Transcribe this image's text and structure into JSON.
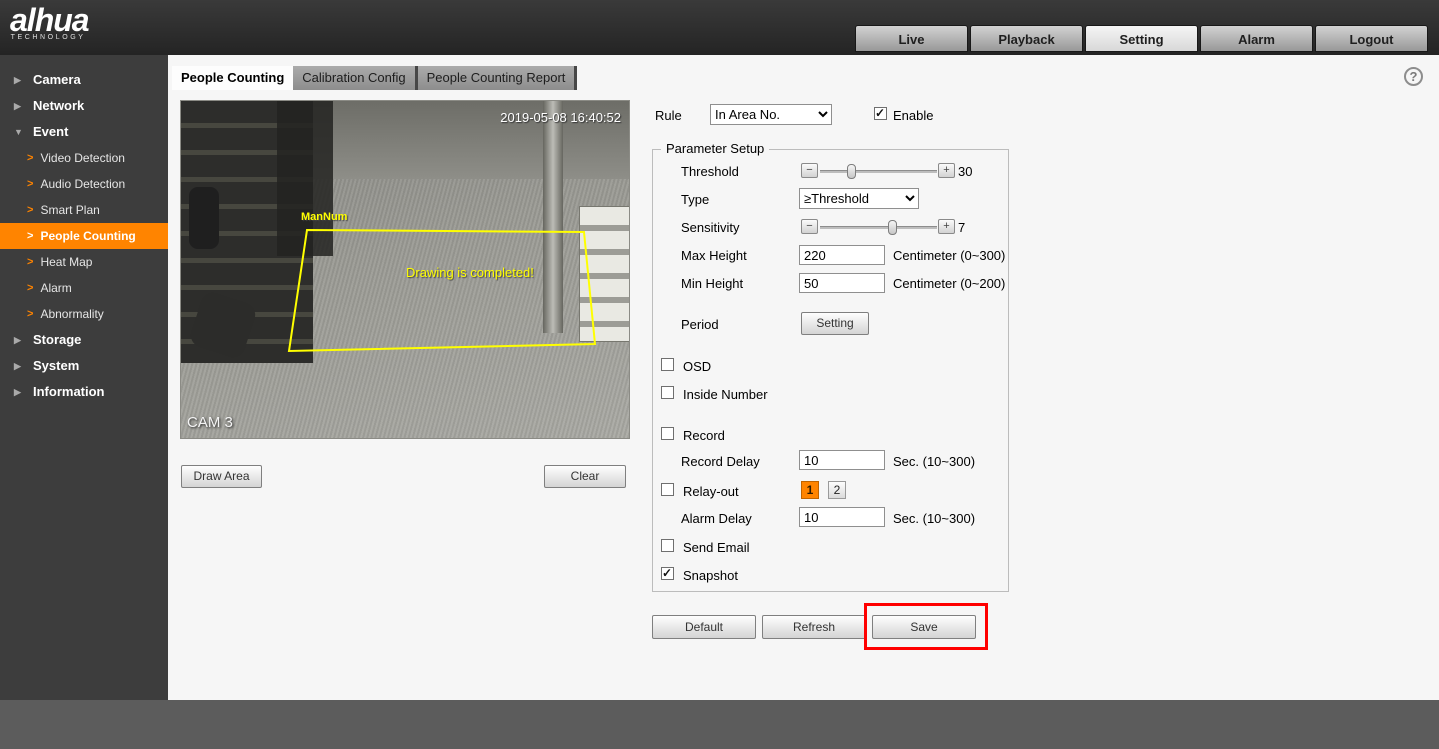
{
  "header": {
    "logo_text": "alhua",
    "logo_sub": "TECHNOLOGY",
    "nav_live": "Live",
    "nav_playback": "Playback",
    "nav_setting": "Setting",
    "nav_alarm": "Alarm",
    "nav_logout": "Logout"
  },
  "icons": {
    "collapsed": "▶",
    "expanded": "▼",
    "sub": ">",
    "help": "?"
  },
  "sidebar": {
    "camera": "Camera",
    "network": "Network",
    "event": "Event",
    "video_detection": "Video Detection",
    "audio_detection": "Audio Detection",
    "smart_plan": "Smart Plan",
    "people_counting": "People Counting",
    "heat_map": "Heat Map",
    "alarm": "Alarm",
    "abnormality": "Abnormality",
    "storage": "Storage",
    "system": "System",
    "information": "Information"
  },
  "tabs": {
    "people_counting": "People Counting",
    "calibration_config": "Calibration Config",
    "people_counting_report": "People Counting Report"
  },
  "video": {
    "timestamp": "2019-05-08 16:40:52",
    "area_label": "ManNum",
    "status_text": "Drawing is completed!",
    "camera_label": "CAM 3"
  },
  "actions": {
    "draw_area": "Draw Area",
    "clear": "Clear"
  },
  "form": {
    "rule_label": "Rule",
    "rule_value": "In Area No.",
    "enable_label": "Enable",
    "group_title": "Parameter Setup",
    "threshold_label": "Threshold",
    "threshold_value": "30",
    "type_label": "Type",
    "type_value": "≥Threshold",
    "sensitivity_label": "Sensitivity",
    "sensitivity_value": "7",
    "max_height_label": "Max Height",
    "max_height_value": "220",
    "max_height_unit": "Centimeter (0~300)",
    "min_height_label": "Min Height",
    "min_height_value": "50",
    "min_height_unit": "Centimeter (0~200)",
    "period_label": "Period",
    "period_button": "Setting",
    "osd_label": "OSD",
    "inside_number_label": "Inside Number",
    "record_label": "Record",
    "record_delay_label": "Record Delay",
    "record_delay_value": "10",
    "record_delay_unit": "Sec. (10~300)",
    "relay_out_label": "Relay-out",
    "relay_1": "1",
    "relay_2": "2",
    "alarm_delay_label": "Alarm Delay",
    "alarm_delay_value": "10",
    "alarm_delay_unit": "Sec. (10~300)",
    "send_email_label": "Send Email",
    "snapshot_label": "Snapshot",
    "minus": "−",
    "plus": "+",
    "checks": {
      "enable": true,
      "osd": false,
      "inside_number": false,
      "record": false,
      "relay_out": false,
      "send_email": false,
      "snapshot": true
    }
  },
  "footer_actions": {
    "default": "Default",
    "refresh": "Refresh",
    "save": "Save"
  },
  "colors": {
    "accent_orange": "#ff8400",
    "annotation_red": "#ff0000",
    "overlay_yellow": "#ffff00"
  }
}
